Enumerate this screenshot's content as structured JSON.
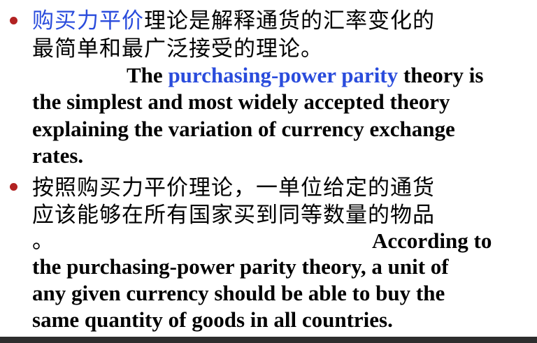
{
  "bullet1": {
    "cn_highlight": "购买力平价",
    "cn_line1_rest": "理论是解释通货的汇率变化的",
    "cn_line2": "最简单和最广泛接受的理论。",
    "en_line1_pre": "The ",
    "en_line1_highlight": "purchasing-power parity",
    "en_line1_post": " theory is",
    "en_line2": "the simplest and most widely accepted theory",
    "en_line3": "explaining the variation of currency exchange",
    "en_line4": "rates."
  },
  "bullet2": {
    "cn_line1": "按照购买力平价理论，一单位给定的通货",
    "cn_line2": "应该能够在所有国家买到同等数量的物品",
    "cn_line3": "。",
    "en_line1": "According to",
    "en_line2": "the purchasing-power parity theory, a unit of",
    "en_line3": "any given currency should be able to buy the",
    "en_line4": "same quantity of goods in all countries."
  },
  "colors": {
    "text": "#000000",
    "highlight": "#2a4cdc",
    "bullet": "#b22222",
    "bottom_bar": "#2e2e2e"
  }
}
